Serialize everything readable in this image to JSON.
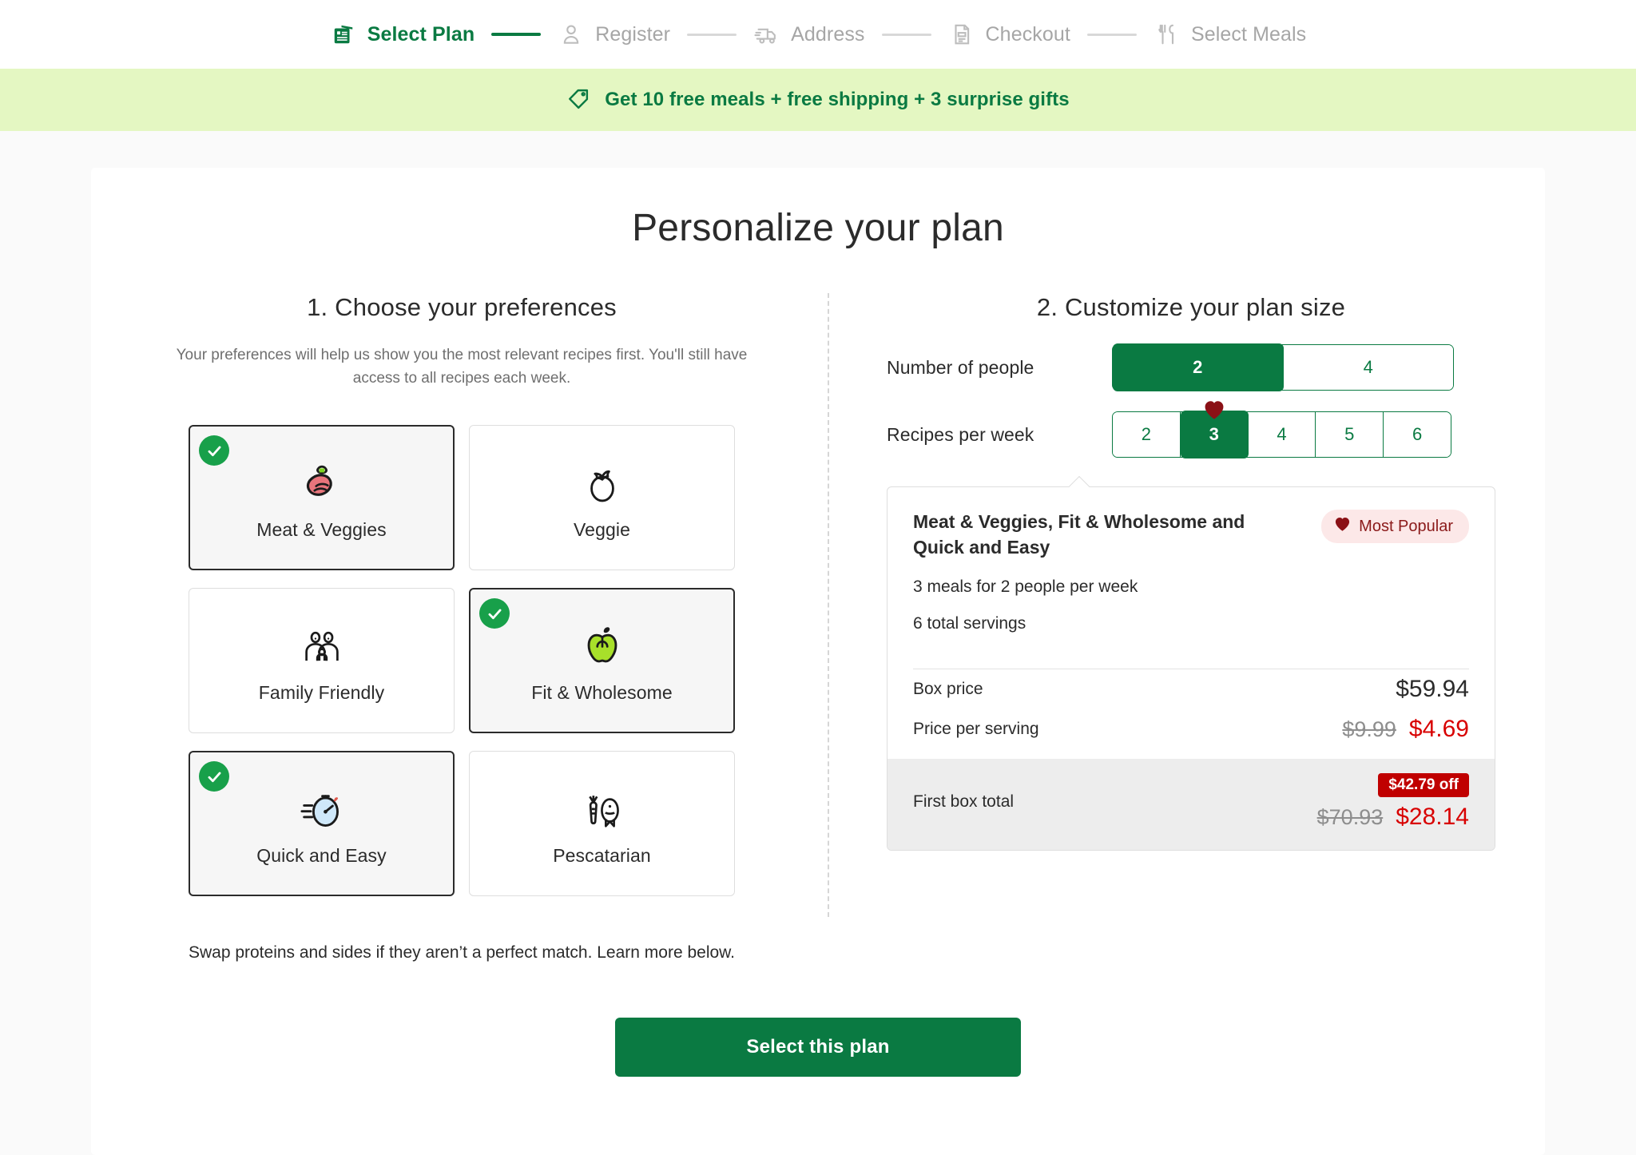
{
  "steps": [
    {
      "label": "Select Plan",
      "icon": "plan-icon",
      "active": true
    },
    {
      "label": "Register",
      "icon": "user-icon",
      "active": false
    },
    {
      "label": "Address",
      "icon": "truck-icon",
      "active": false
    },
    {
      "label": "Checkout",
      "icon": "receipt-icon",
      "active": false
    },
    {
      "label": "Select Meals",
      "icon": "cutlery-icon",
      "active": false
    }
  ],
  "promo": {
    "icon": "tag-icon",
    "text": "Get 10 free meals + free shipping + 3 surprise gifts",
    "background": "#e4f7c2",
    "text_color": "#0a7a42"
  },
  "page_title": "Personalize your plan",
  "preferences_section": {
    "title": "1. Choose your preferences",
    "description": "Your preferences will help us show you the most relevant recipes first. You'll still have access to all recipes each week.",
    "footnote": "Swap proteins and sides if they aren’t a perfect match. Learn more below.",
    "options": [
      {
        "label": "Meat & Veggies",
        "icon": "steak-icon",
        "selected": true
      },
      {
        "label": "Veggie",
        "icon": "tomato-icon",
        "selected": false
      },
      {
        "label": "Family Friendly",
        "icon": "family-icon",
        "selected": false
      },
      {
        "label": "Fit & Wholesome",
        "icon": "apple-icon",
        "selected": true
      },
      {
        "label": "Quick and Easy",
        "icon": "stopwatch-icon",
        "selected": true
      },
      {
        "label": "Pescatarian",
        "icon": "fish-carrot-icon",
        "selected": false
      }
    ]
  },
  "plan_size_section": {
    "title": "2. Customize your plan size",
    "people": {
      "label": "Number of people",
      "options": [
        "2",
        "4"
      ],
      "selected": "2"
    },
    "recipes": {
      "label": "Recipes per week",
      "options": [
        "2",
        "3",
        "4",
        "5",
        "6"
      ],
      "selected": "3",
      "heart_marker_on": "3"
    }
  },
  "summary": {
    "title": "Meat & Veggies, Fit & Wholesome and Quick and Easy",
    "badge": {
      "label": "Most Popular",
      "icon": "heart-icon"
    },
    "meals_line": "3 meals for 2 people per week",
    "servings_line": "6 total servings",
    "rows": [
      {
        "label": "Box price",
        "value": "$59.94",
        "old": null,
        "discounted": false
      },
      {
        "label": "Price per serving",
        "value": "$4.69",
        "old": "$9.99",
        "discounted": true
      }
    ],
    "total": {
      "label": "First box total",
      "off_badge": "$42.79 off",
      "old": "$70.93",
      "value": "$28.14"
    }
  },
  "cta": {
    "label": "Select this plan"
  },
  "colors": {
    "brand_green": "#0a7a42",
    "check_green": "#18a04a",
    "promo_bg": "#e4f7c2",
    "discount_red": "#d80000",
    "off_badge_red": "#c00000",
    "badge_pink_bg": "#fce8e8",
    "badge_red_text": "#8b1a1a"
  }
}
